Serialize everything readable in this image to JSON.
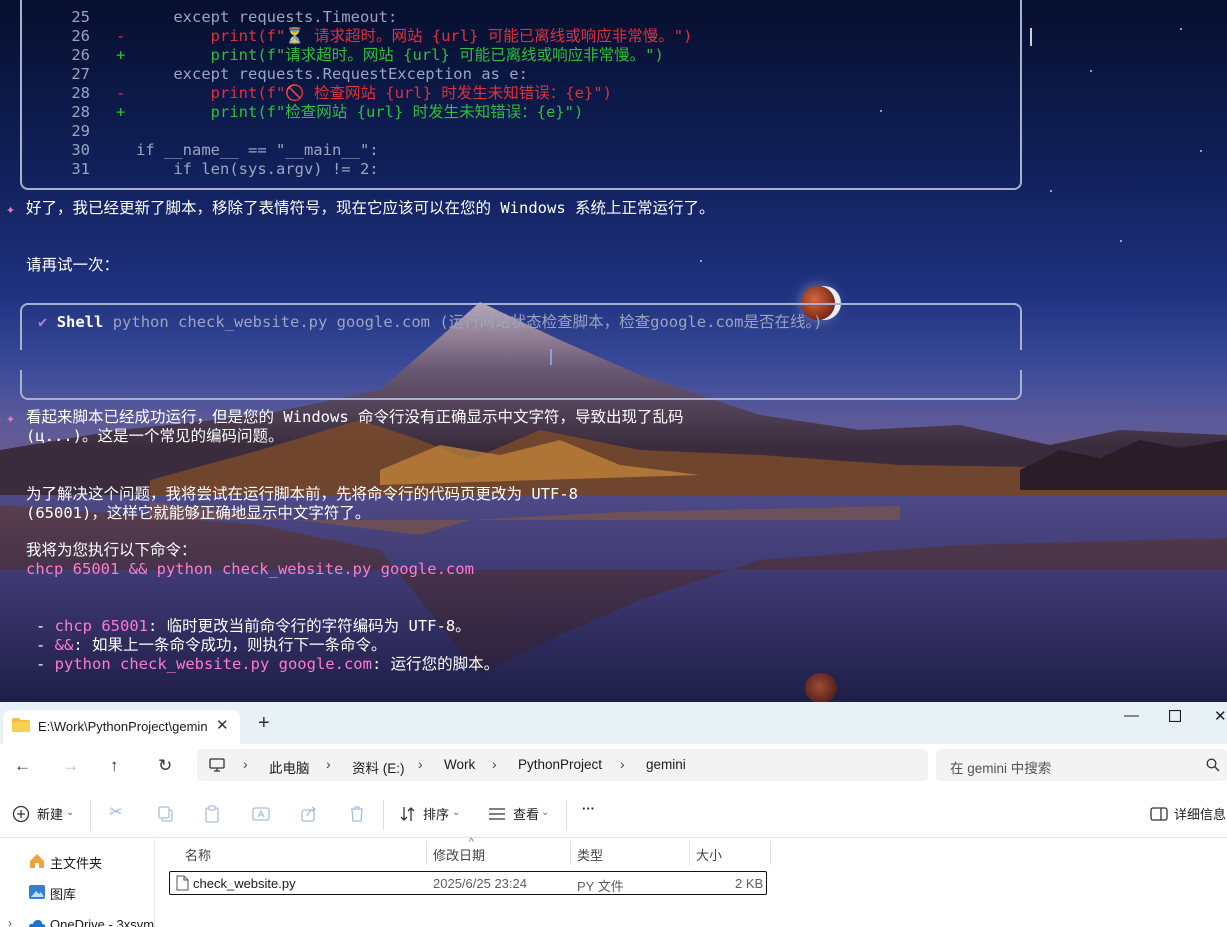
{
  "terminal": {
    "diff_lines": [
      {
        "num": "25",
        "sign": "",
        "code": "    except requests.Timeout:",
        "kind": "ctx"
      },
      {
        "num": "26",
        "sign": "-",
        "code": "        print(f\"⏳ 请求超时。网站 {url} 可能已离线或响应非常慢。\")",
        "kind": "del"
      },
      {
        "num": "26",
        "sign": "+",
        "code": "        print(f\"请求超时。网站 {url} 可能已离线或响应非常慢。\")",
        "kind": "add"
      },
      {
        "num": "27",
        "sign": "",
        "code": "    except requests.RequestException as e:",
        "kind": "ctx"
      },
      {
        "num": "28",
        "sign": "-",
        "code": "        print(f\"🚫 检查网站 {url} 时发生未知错误：{e}\")",
        "kind": "del"
      },
      {
        "num": "28",
        "sign": "+",
        "code": "        print(f\"检查网站 {url} 时发生未知错误：{e}\")",
        "kind": "add"
      },
      {
        "num": "29",
        "sign": "",
        "code": "",
        "kind": "ctx"
      },
      {
        "num": "30",
        "sign": "",
        "code": "if __name__ == \"__main__\":",
        "kind": "ctx"
      },
      {
        "num": "31",
        "sign": "",
        "code": "    if len(sys.argv) != 2:",
        "kind": "ctx"
      }
    ],
    "msg1": "好了，我已经更新了脚本，移除了表情符号，现在它应该可以在您的 Windows 系统上正常运行了。",
    "msg_retry": "请再试一次：",
    "shell": {
      "label": "Shell",
      "command": "python check_website.py google.com (运行网站状态检查脚本，检查google.com是否在线。)"
    },
    "msg2_line1": "看起来脚本已经成功运行，但是您的 Windows 命令行没有正确显示中文字符，导致出现了乱码",
    "msg2_line2": "(ц...)。这是一个常见的编码问题。",
    "msg3_line1": "为了解决这个问题，我将尝试在运行脚本前，先将命令行的代码页更改为 UTF-8",
    "msg3_line2": "(65001)，这样它就能够正确地显示中文字符了。",
    "msg4": "我将为您执行以下命令：",
    "command": "chcp 65001 && python check_website.py google.com",
    "bullets": [
      {
        "code": "chcp 65001",
        "text": ": 临时更改当前命令行的字符编码为 UTF-8。"
      },
      {
        "code": "&&",
        "text": ": 如果上一条命令成功，则执行下一条命令。"
      },
      {
        "code": "python check_website.py google.com",
        "text": ": 运行您的脚本。"
      }
    ]
  },
  "explorer": {
    "tab_title": "E:\\Work\\PythonProject\\gemin",
    "breadcrumbs": [
      "此电脑",
      "资料 (E:)",
      "Work",
      "PythonProject",
      "gemini"
    ],
    "search_placeholder": "在 gemini 中搜索",
    "commands": {
      "new": "新建",
      "sort": "排序",
      "view": "查看",
      "more": "···",
      "details": "详细信息"
    },
    "sidebar": [
      {
        "label": "主文件夹",
        "icon": "home-icon"
      },
      {
        "label": "图库",
        "icon": "gallery-icon"
      },
      {
        "label": "OneDrive - 3xsvm",
        "icon": "onedrive-icon"
      }
    ],
    "columns": [
      "名称",
      "修改日期",
      "类型",
      "大小"
    ],
    "files": [
      {
        "name": "check_website.py",
        "modified": "2025/6/25 23:24",
        "type": "PY 文件",
        "size": "2 KB"
      }
    ]
  },
  "colors": {
    "diff_deleted": "#e0303a",
    "diff_added": "#2fbf3a",
    "highlight_code": "#ff7ad1",
    "frame_border": "#a7b0cc",
    "accent_check": "#a97ae8"
  }
}
